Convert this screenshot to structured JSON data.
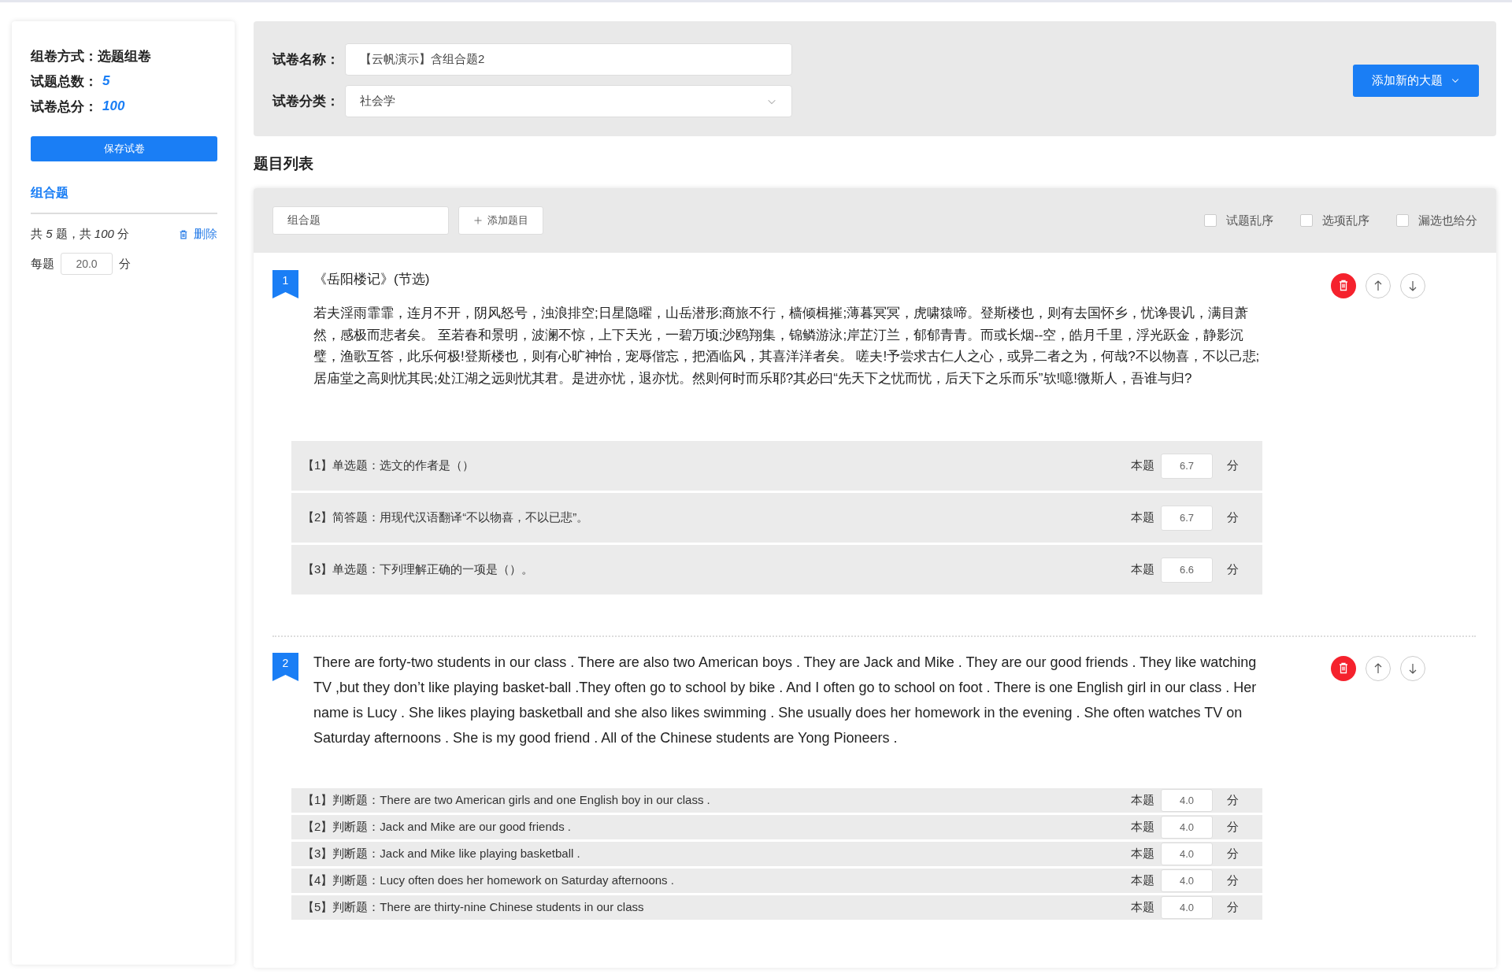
{
  "sidebar": {
    "fields": [
      {
        "label": "组卷方式：",
        "value": "选题组卷",
        "kind": "plain"
      },
      {
        "label": "试题总数：",
        "value": "5",
        "kind": "highlight"
      },
      {
        "label": "试卷总分：",
        "value": "100",
        "kind": "highlight"
      }
    ],
    "save_button": "保存试卷",
    "section": {
      "title": "组合题",
      "summary": "共 *5* 题，共 *100* 分",
      "delete": "删除",
      "per_label": "每题",
      "per_value": "20.0",
      "per_unit": "分"
    }
  },
  "header": {
    "name_label": "试卷名称：",
    "name_value": "【云帆演示】含组合题2",
    "category_label": "试卷分类：",
    "category_value": "社会学",
    "add_button": "添加新的大题"
  },
  "list_title": "题目列表",
  "toolbar": {
    "group_value": "组合题",
    "add_question": "添加题目",
    "options": [
      {
        "label": "试题乱序",
        "checked": false
      },
      {
        "label": "选项乱序",
        "checked": false
      },
      {
        "label": "漏选也给分",
        "checked": false
      }
    ]
  },
  "questions": [
    {
      "number": "1",
      "title": "《岳阳楼记》(节选)",
      "body": "若夫淫雨霏霏，连月不开，阴风怒号，浊浪排空;日星隐曜，山岳潜形;商旅不行，樯倾楫摧;薄暮冥冥，虎啸猿啼。登斯楼也，则有去国怀乡，忧谗畏讥，满目萧然，感极而悲者矣。 至若春和景明，波澜不惊，上下天光，一碧万顷;沙鸥翔集，锦鳞游泳;岸芷汀兰，郁郁青青。而或长烟--空，皓月千里，浮光跃金，静影沉璧，渔歌互答，此乐何极!登斯楼也，则有心旷神怡，宠辱偕忘，把酒临风，其喜洋洋者矣。 嗟夫!予尝求古仁人之心，或异二者之为，何哉?不以物喜，不以己悲;居庙堂之高则忧其民;处江湖之远则忧其君。是进亦忧，退亦忧。然则何时而乐耶?其必曰“先天下之忧而忧，后天下之乐而乐”欤!噫!微斯人，吾谁与归?",
      "kind": "chinese_passage",
      "subquestions": [
        {
          "kind": "choice",
          "text": "【1】单选题：选文的作者是（）",
          "score_label": "本题",
          "score": "6.7",
          "unit": "分"
        },
        {
          "kind": "short_answer",
          "text": "【2】简答题：用现代汉语翻译“不以物喜，不以已悲”。",
          "score_label": "本题",
          "score": "6.7",
          "unit": "分"
        },
        {
          "kind": "choice",
          "text": "【3】单选题：下列理解正确的一项是（）。",
          "score_label": "本题",
          "score": "6.6",
          "unit": "分"
        }
      ]
    },
    {
      "number": "2",
      "body": "There are forty-two students in our class . There are also two American boys . They are Jack and Mike . They are our good friends . They like watching TV ,but they don’t like playing basket-ball .They often go to school by bike . And I often go to school on foot . There is one English girl in our class . Her name is Lucy . She likes playing basketball and she also likes swimming . She usually does her homework in the evening . She often watches TV on Saturday afternoons . She is my good friend . All of the Chinese students are Yong Pioneers .",
      "kind": "english_passage",
      "subquestions": [
        {
          "kind": "true_false",
          "text": "【1】判断题：There are two American girls and one English boy in our class .",
          "score_label": "本题",
          "score": "4.0",
          "unit": "分"
        },
        {
          "kind": "true_false",
          "text": "【2】判断题：Jack and Mike are our good friends .",
          "score_label": "本题",
          "score": "4.0",
          "unit": "分"
        },
        {
          "kind": "true_false",
          "text": "【3】判断题：Jack and Mike like playing basketball .",
          "score_label": "本题",
          "score": "4.0",
          "unit": "分"
        },
        {
          "kind": "true_false",
          "text": "【4】判断题：Lucy often does her homework on Saturday afternoons .",
          "score_label": "本题",
          "score": "4.0",
          "unit": "分"
        },
        {
          "kind": "true_false",
          "text": "【5】判断题：There are thirty-nine Chinese students in our class",
          "score_label": "本题",
          "score": "4.0",
          "unit": "分"
        }
      ]
    }
  ]
}
